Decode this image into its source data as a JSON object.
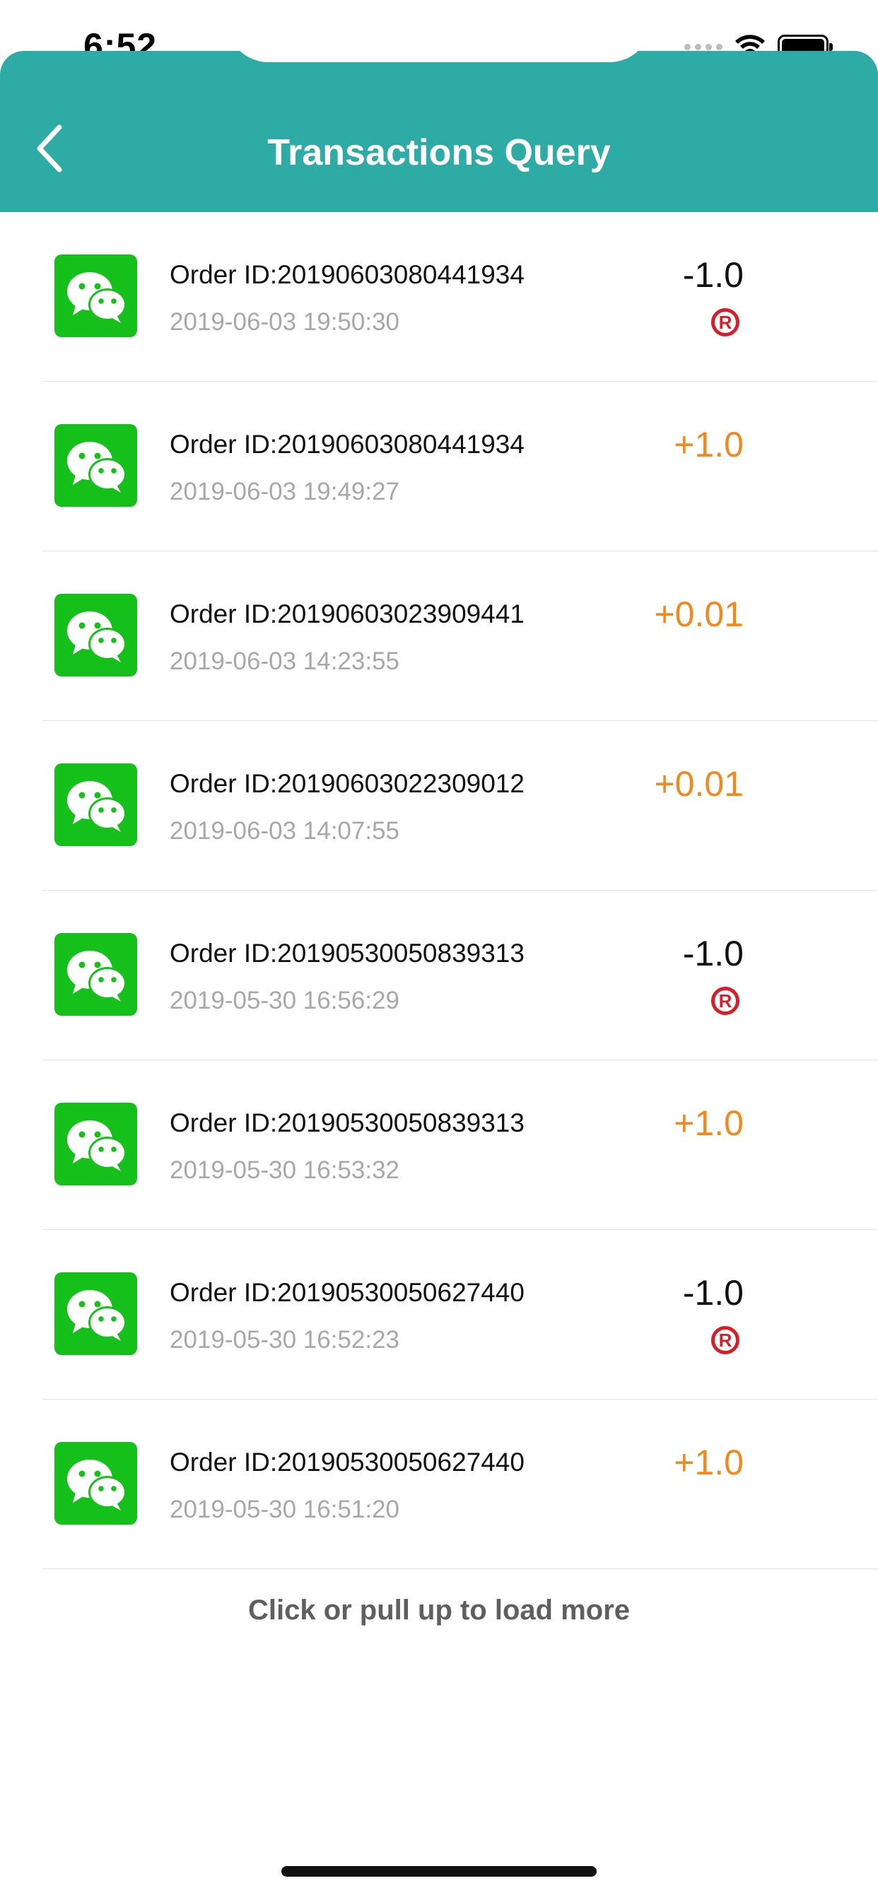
{
  "status_bar": {
    "time": "6:52"
  },
  "header": {
    "title": "Transactions Query",
    "color": "#2eaba4"
  },
  "transactions": [
    {
      "order_id": "Order ID:20190603080441934",
      "datetime": "2019-06-03 19:50:30",
      "amount": "-1.0",
      "refund_mark": "R",
      "type": "negative"
    },
    {
      "order_id": "Order ID:20190603080441934",
      "datetime": "2019-06-03 19:49:27",
      "amount": "+1.0",
      "refund_mark": "",
      "type": "positive"
    },
    {
      "order_id": "Order ID:20190603023909441",
      "datetime": "2019-06-03 14:23:55",
      "amount": "+0.01",
      "refund_mark": "",
      "type": "positive"
    },
    {
      "order_id": "Order ID:20190603022309012",
      "datetime": "2019-06-03 14:07:55",
      "amount": "+0.01",
      "refund_mark": "",
      "type": "positive"
    },
    {
      "order_id": "Order ID:20190530050839313",
      "datetime": "2019-05-30 16:56:29",
      "amount": "-1.0",
      "refund_mark": "R",
      "type": "negative"
    },
    {
      "order_id": "Order ID:20190530050839313",
      "datetime": "2019-05-30 16:53:32",
      "amount": "+1.0",
      "refund_mark": "",
      "type": "positive"
    },
    {
      "order_id": "Order ID:20190530050627440",
      "datetime": "2019-05-30 16:52:23",
      "amount": "-1.0",
      "refund_mark": "R",
      "type": "negative"
    },
    {
      "order_id": "Order ID:20190530050627440",
      "datetime": "2019-05-30 16:51:20",
      "amount": "+1.0",
      "refund_mark": "",
      "type": "positive"
    }
  ],
  "load_more": "Click or pull up to load more",
  "colors": {
    "positive_amount": "#f08a1e",
    "negative_amount": "#111111",
    "refund_mark": "#d71f2b",
    "app_icon": "#16c01b"
  }
}
